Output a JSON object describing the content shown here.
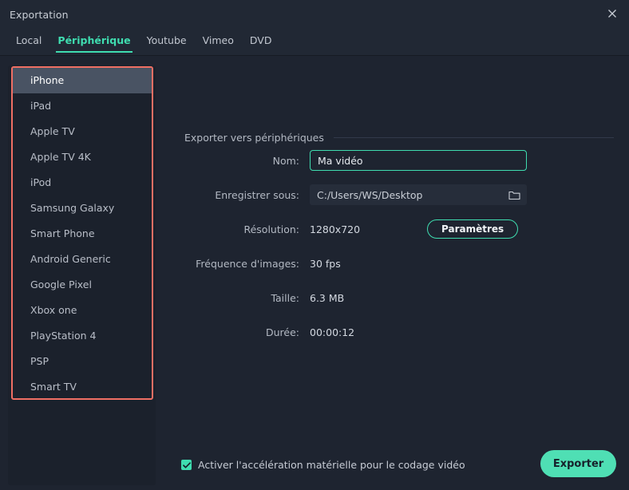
{
  "window": {
    "title": "Exportation",
    "close_icon": "close-icon"
  },
  "tabs": [
    {
      "label": "Local",
      "active": false
    },
    {
      "label": "Périphérique",
      "active": true
    },
    {
      "label": "Youtube",
      "active": false
    },
    {
      "label": "Vimeo",
      "active": false
    },
    {
      "label": "DVD",
      "active": false
    }
  ],
  "sidebar": {
    "items": [
      {
        "label": "iPhone",
        "selected": true
      },
      {
        "label": "iPad",
        "selected": false
      },
      {
        "label": "Apple TV",
        "selected": false
      },
      {
        "label": "Apple TV 4K",
        "selected": false
      },
      {
        "label": "iPod",
        "selected": false
      },
      {
        "label": "Samsung Galaxy",
        "selected": false
      },
      {
        "label": "Smart Phone",
        "selected": false
      },
      {
        "label": "Android Generic",
        "selected": false
      },
      {
        "label": "Google Pixel",
        "selected": false
      },
      {
        "label": "Xbox one",
        "selected": false
      },
      {
        "label": "PlayStation 4",
        "selected": false
      },
      {
        "label": "PSP",
        "selected": false
      },
      {
        "label": "Smart TV",
        "selected": false
      }
    ],
    "highlight_color": "#ef6f64"
  },
  "main": {
    "section_title": "Exporter vers périphériques",
    "fields": {
      "name_label": "Nom:",
      "name_value": "Ma vidéo",
      "name_placeholder": "Ma vidéo",
      "save_label": "Enregistrer sous:",
      "save_value": "C:/Users/WS/Desktop",
      "folder_icon": "folder-icon",
      "resolution_label": "Résolution:",
      "resolution_value": "1280x720",
      "settings_button": "Paramètres",
      "framerate_label": "Fréquence d'images:",
      "framerate_value": "30 fps",
      "size_label": "Taille:",
      "size_value": "6.3 MB",
      "duration_label": "Durée:",
      "duration_value": "00:00:12"
    }
  },
  "footer": {
    "hw_accel_label": "Activer l'accélération matérielle pour le codage vidéo",
    "hw_accel_checked": true,
    "export_button": "Exporter"
  },
  "colors": {
    "accent": "#3fddb0",
    "export_fill": "#4fdfb4",
    "highlight_border": "#ef6f64",
    "window_bg": "#212834",
    "content_bg": "#1e2430"
  }
}
